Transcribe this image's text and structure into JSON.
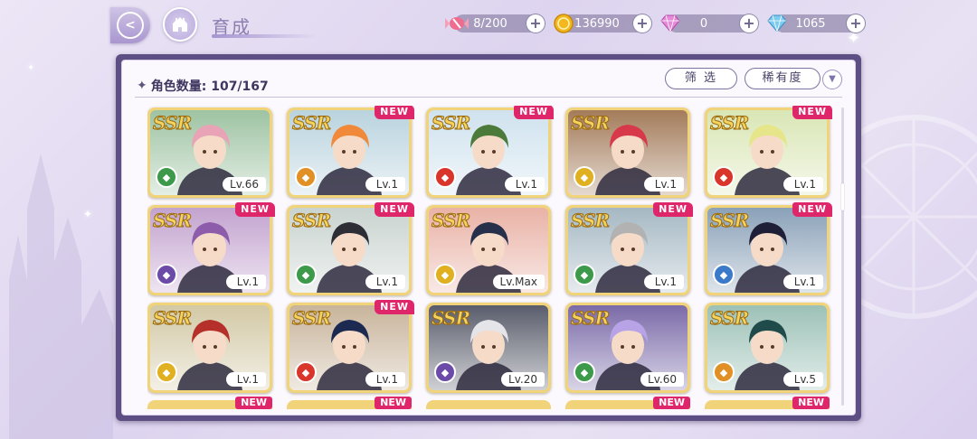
{
  "header": {
    "title": "育成",
    "back_icon": "back-arrow-icon",
    "home_icon": "castle-home-icon"
  },
  "resources": [
    {
      "name": "candy",
      "icon": "candy-icon",
      "value": "8/200"
    },
    {
      "name": "coin",
      "icon": "coin-icon",
      "value": "136990"
    },
    {
      "name": "pink-gem",
      "icon": "pink-diamond-icon",
      "value": "0"
    },
    {
      "name": "blue-gem",
      "icon": "blue-diamond-icon",
      "value": "1065"
    }
  ],
  "panel": {
    "count_label": "角色数量: 107/167",
    "filter_label": "筛 选",
    "sort_label": "稀有度",
    "sort_toggle_icon": "chevron-down-icon"
  },
  "cards": [
    {
      "rarity": "SSR",
      "new": false,
      "new_label": "",
      "level": "Lv.66",
      "attr_color": "#3c9a4a",
      "hair": "#e9a3b6",
      "bg": "#9ec3a2"
    },
    {
      "rarity": "SSR",
      "new": true,
      "new_label": "NEW",
      "level": "Lv.1",
      "attr_color": "#e09024",
      "hair": "#f08a3a",
      "bg": "#b9d3de"
    },
    {
      "rarity": "SSR",
      "new": true,
      "new_label": "NEW",
      "level": "Lv.1",
      "attr_color": "#d9352b",
      "hair": "#4c7a3a",
      "bg": "#cfe2ee"
    },
    {
      "rarity": "SSR",
      "new": false,
      "new_label": "",
      "level": "Lv.1",
      "attr_color": "#e0b020",
      "hair": "#d8394a",
      "bg": "#a37b5a"
    },
    {
      "rarity": "SSR",
      "new": true,
      "new_label": "NEW",
      "level": "Lv.1",
      "attr_color": "#d9352b",
      "hair": "#e6e58a",
      "bg": "#d9e6b5"
    },
    {
      "rarity": "SSR",
      "new": true,
      "new_label": "NEW",
      "level": "Lv.1",
      "attr_color": "#6b4aa8",
      "hair": "#8d5cab",
      "bg": "#c3a3cf"
    },
    {
      "rarity": "SSR",
      "new": true,
      "new_label": "NEW",
      "level": "Lv.1",
      "attr_color": "#3c9a4a",
      "hair": "#2d2d35",
      "bg": "#c9d3cf"
    },
    {
      "rarity": "SSR",
      "new": false,
      "new_label": "",
      "level": "Lv.Max",
      "attr_color": "#e0b020",
      "hair": "#26304a",
      "bg": "#e9b2a6"
    },
    {
      "rarity": "SSR",
      "new": true,
      "new_label": "NEW",
      "level": "Lv.1",
      "attr_color": "#3c9a4a",
      "hair": "#b2b2b2",
      "bg": "#a5b8c3"
    },
    {
      "rarity": "SSR",
      "new": true,
      "new_label": "NEW",
      "level": "Lv.1",
      "attr_color": "#3a7ac9",
      "hair": "#1f2038",
      "bg": "#8aa1b8"
    },
    {
      "rarity": "SSR",
      "new": false,
      "new_label": "",
      "level": "Lv.1",
      "attr_color": "#e0b020",
      "hair": "#b5302b",
      "bg": "#d3c9a6"
    },
    {
      "rarity": "SSR",
      "new": true,
      "new_label": "NEW",
      "level": "Lv.1",
      "attr_color": "#d9352b",
      "hair": "#1c2a52",
      "bg": "#c8b49b"
    },
    {
      "rarity": "SSR",
      "new": false,
      "new_label": "",
      "level": "Lv.20",
      "attr_color": "#6b4aa8",
      "hair": "#e4e4e9",
      "bg": "#595c6b"
    },
    {
      "rarity": "SSR",
      "new": false,
      "new_label": "",
      "level": "Lv.60",
      "attr_color": "#3c9a4a",
      "hair": "#b7a3e6",
      "bg": "#7a6aa8"
    },
    {
      "rarity": "SSR",
      "new": false,
      "new_label": "",
      "level": "Lv.5",
      "attr_color": "#e09024",
      "hair": "#1f4b4a",
      "bg": "#9cc1b6"
    }
  ],
  "next_row_peek": [
    {
      "new": true,
      "new_label": "NEW"
    },
    {
      "new": true,
      "new_label": "NEW"
    },
    {
      "new": false,
      "new_label": ""
    },
    {
      "new": true,
      "new_label": "NEW"
    },
    {
      "new": true,
      "new_label": "NEW"
    }
  ]
}
